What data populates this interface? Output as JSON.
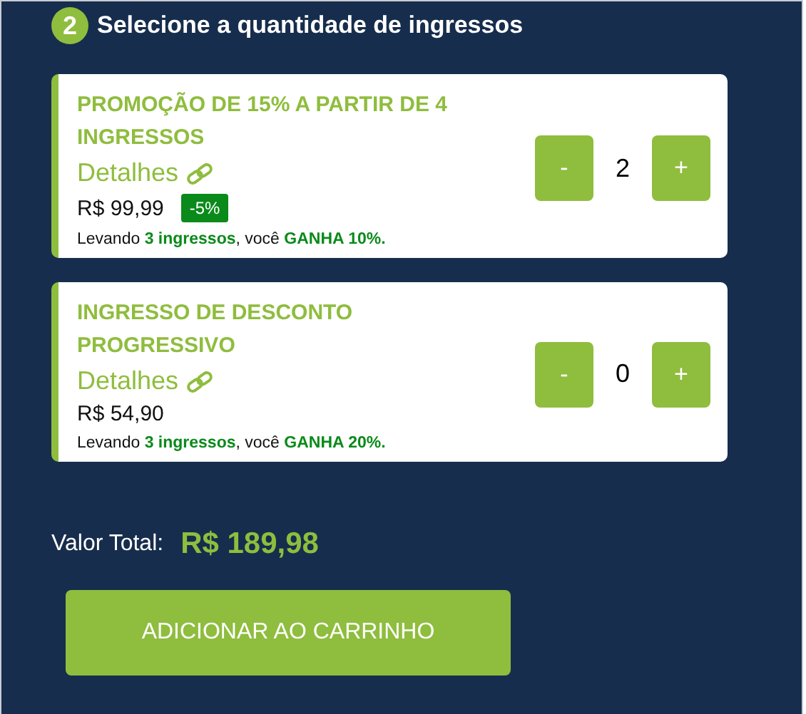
{
  "step": {
    "number": "2",
    "title": "Selecione a quantidade de ingressos"
  },
  "tickets": [
    {
      "name": "PROMOÇÃO DE 15% A PARTIR DE 4 INGRESSOS",
      "details": "Detalhes",
      "price": "R$ 99,99",
      "badge": "-5%",
      "note": "Levando **3 ingressos**, você **GANHA 10%.**",
      "minus": "-",
      "quantity": "2",
      "plus": "+"
    },
    {
      "name": "INGRESSO DE DESCONTO PROGRESSIVO",
      "details": "Detalhes",
      "price": "R$ 54,90",
      "note": "Levando **3 ingressos**, você **GANHA 20%.**",
      "minus": "-",
      "quantity": "0",
      "plus": "+"
    }
  ],
  "total": {
    "label": "Valor Total:",
    "value": "R$ 189,98"
  },
  "add_button": "ADICIONAR AO CARRINHO"
}
